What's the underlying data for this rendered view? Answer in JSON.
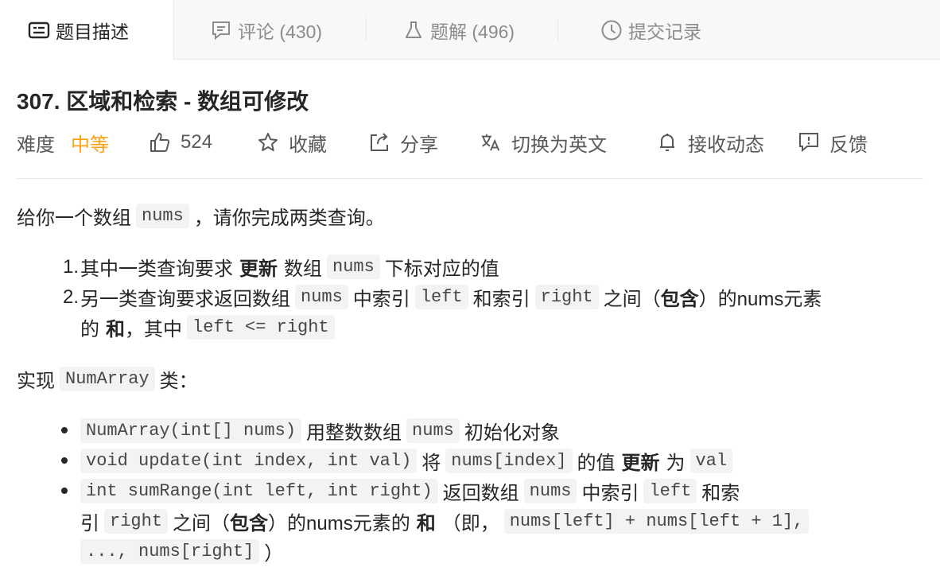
{
  "tabs": {
    "description": "题目描述",
    "comments": "评论 (430)",
    "solutions": "题解 (496)",
    "submissions": "提交记录"
  },
  "problem": {
    "title": "307. 区域和检索 - 数组可修改",
    "difficulty_label": "难度",
    "difficulty": "中等",
    "difficulty_color": "#ffa116",
    "likes": "524",
    "favorite": "收藏",
    "share": "分享",
    "switch_lang": "切换为英文",
    "notify": "接收动态",
    "feedback": "反馈"
  },
  "content": {
    "intro_a": "给你一个数组",
    "intro_code": "nums",
    "intro_b": "，请你完成两类查询。",
    "ol": [
      {
        "num": "1.",
        "a": "其中一类查询要求",
        "b1": "更新",
        "c": "数组",
        "code1": "nums",
        "d": "下标对应的值"
      },
      {
        "num": "2.",
        "a": "另一类查询要求返回数组",
        "code1": "nums",
        "b": "中索引",
        "code2": "left",
        "c": "和索引",
        "code3": "right",
        "d": "之间（",
        "b1": "包含",
        "e": "）的nums元素",
        "f": "的",
        "b2": "和",
        "g": "，其中",
        "code4": "left <= right"
      }
    ],
    "impl_a": "实现",
    "impl_code": "NumArray",
    "impl_b": "类：",
    "ul": [
      {
        "code1": "NumArray(int[] nums)",
        "a": "用整数数组",
        "code2": "nums",
        "b": "初始化对象"
      },
      {
        "code1": "void update(int index, int val)",
        "a": "将",
        "code2": "nums[index]",
        "b": "的值",
        "b1": "更新",
        "c": "为",
        "code3": "val"
      },
      {
        "code1": "int sumRange(int left, int right)",
        "a": "返回数组",
        "code2": "nums",
        "b": "中索引",
        "code3": "left",
        "c": "和索",
        "d": "引",
        "code4": "right",
        "e": "之间（",
        "b1": "包含",
        "f": "）的nums元素的",
        "b2": "和",
        "g": "（即，",
        "code5": "nums[left] + nums[left + 1],",
        "code6": "..., nums[right]",
        "h": "）"
      }
    ]
  },
  "icons": {
    "description": "document-icon",
    "comments": "comment-icon",
    "solutions": "flask-icon",
    "submissions": "clock-icon",
    "likes": "thumbs-up-icon",
    "favorite": "star-icon",
    "share": "share-icon",
    "switch_lang": "translate-icon",
    "notify": "bell-icon",
    "feedback": "feedback-icon"
  }
}
